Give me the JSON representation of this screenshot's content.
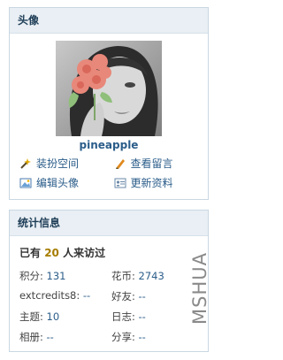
{
  "avatar_panel": {
    "title": "头像",
    "username": "pineapple",
    "links": [
      {
        "label": "装扮空间",
        "icon": "wand-icon"
      },
      {
        "label": "查看留言",
        "icon": "pencil-icon"
      },
      {
        "label": "编辑头像",
        "icon": "image-icon"
      },
      {
        "label": "更新资料",
        "icon": "profile-card-icon"
      }
    ]
  },
  "stats_panel": {
    "title": "统计信息",
    "visitors_prefix": "已有",
    "visitors_count": "20",
    "visitors_suffix": "人来访过",
    "items": [
      {
        "label": "积分:",
        "value": "131"
      },
      {
        "label": "花币:",
        "value": "2743"
      },
      {
        "label": "extcredits8:",
        "value": "--"
      },
      {
        "label": "好友:",
        "value": "--"
      },
      {
        "label": "主题:",
        "value": "10"
      },
      {
        "label": "日志:",
        "value": "--"
      },
      {
        "label": "相册:",
        "value": "--"
      },
      {
        "label": "分享:",
        "value": "--"
      }
    ]
  },
  "watermark": "MSHUA",
  "colors": {
    "panel_header_bg": "#e9eff4",
    "border": "#c9d7e2",
    "link": "#2b5d8a",
    "count": "#a67c00"
  }
}
